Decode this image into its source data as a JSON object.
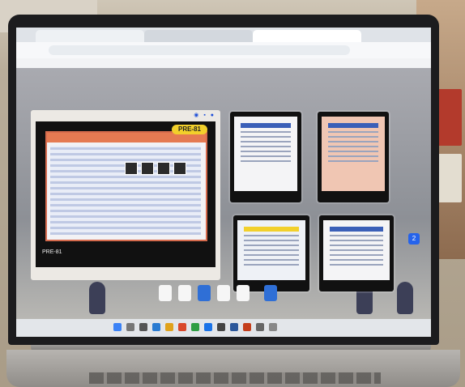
{
  "browser": {
    "tabs": [
      {
        "label": ""
      },
      {
        "label": ""
      },
      {
        "label": ""
      }
    ],
    "url": ""
  },
  "task_view": {
    "focused_window": {
      "slide_title": "PRE-81",
      "caption": "PRE-81",
      "subcaption": ""
    },
    "thumbnail_count": 4,
    "badge": "2"
  },
  "colors": {
    "laptop_bezel": "#1c1c1e",
    "slide_header": "#e57a52",
    "slide_title_pill": "#f2d02b",
    "accent_blue": "#2563eb"
  }
}
